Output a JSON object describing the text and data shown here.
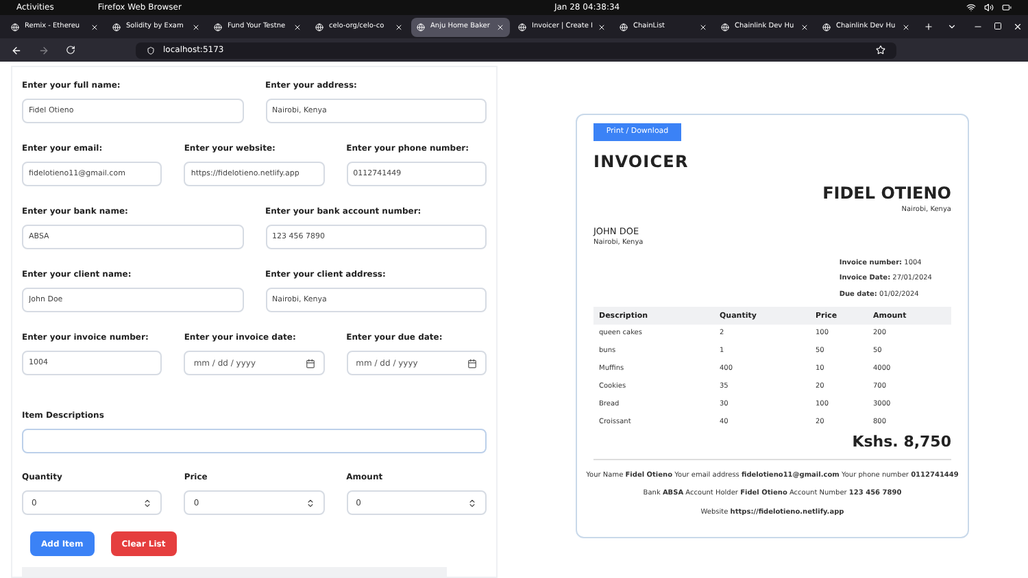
{
  "system_bar": {
    "activities": "Activities",
    "app": "Firefox Web Browser",
    "clock": "Jan 28  04:38:34"
  },
  "tabs": [
    {
      "title": "Remix - Ethereu",
      "selected": false
    },
    {
      "title": "Solidity by Exam",
      "selected": false
    },
    {
      "title": "Fund Your Testne",
      "selected": false
    },
    {
      "title": "celo-org/celo-co",
      "selected": false
    },
    {
      "title": "Anju Home Baker",
      "selected": true
    },
    {
      "title": "Invoicer | Create I",
      "selected": false
    },
    {
      "title": "ChainList",
      "selected": false
    },
    {
      "title": "Chainlink Dev Hu",
      "selected": false
    },
    {
      "title": "Chainlink Dev Hu",
      "selected": false
    }
  ],
  "url": "localhost:5173",
  "form": {
    "rows": [
      [
        {
          "label": "Enter your full name:",
          "value": "Fidel Otieno",
          "kind": "text"
        },
        {
          "label": "Enter your address:",
          "value": "Nairobi, Kenya",
          "kind": "text"
        }
      ],
      [
        {
          "label": "Enter your email:",
          "value": "fidelotieno11@gmail.com",
          "kind": "text"
        },
        {
          "label": "Enter your website:",
          "value": "https://fidelotieno.netlify.app",
          "kind": "text"
        },
        {
          "label": "Enter your phone number:",
          "value": "0112741449",
          "kind": "text"
        }
      ],
      [
        {
          "label": "Enter your bank name:",
          "value": "ABSA",
          "kind": "text"
        },
        {
          "label": "Enter your bank account number:",
          "value": "123 456 7890",
          "kind": "text"
        }
      ],
      [
        {
          "label": "Enter your client name:",
          "value": "John Doe",
          "kind": "text"
        },
        {
          "label": "Enter your client address:",
          "value": "Nairobi, Kenya",
          "kind": "text"
        }
      ],
      [
        {
          "label": "Enter your invoice number:",
          "value": "1004",
          "kind": "text"
        },
        {
          "label": "Enter your invoice date:",
          "value": "mm / dd / yyyy",
          "kind": "date"
        },
        {
          "label": "Enter your due date:",
          "value": "mm / dd / yyyy",
          "kind": "date"
        }
      ]
    ],
    "item_description": {
      "label": "Item Descriptions"
    },
    "item_numbers": [
      {
        "label": "Quantity",
        "value": "0"
      },
      {
        "label": "Price",
        "value": "0"
      },
      {
        "label": "Amount",
        "value": "0"
      }
    ],
    "buttons": [
      {
        "label": "Add Item",
        "kind": "primary"
      },
      {
        "label": "Clear List",
        "kind": "danger"
      }
    ]
  },
  "invoice": {
    "print_button": "Print / Download",
    "title": "INVOICER",
    "sender_name": "FIDEL OTIENO",
    "sender_address": "Nairobi, Kenya",
    "client_name": "JOHN DOE",
    "client_address": "Nairobi, Kenya",
    "meta": [
      {
        "label": "Invoice number:",
        "value": "1004"
      },
      {
        "label": "Invoice Date:",
        "value": "27/01/2024"
      },
      {
        "label": "Due date:",
        "value": "01/02/2024"
      }
    ],
    "table": {
      "columns": [
        "Description",
        "Quantity",
        "Price",
        "Amount"
      ],
      "rows": [
        [
          "queen cakes",
          "2",
          "100",
          "200"
        ],
        [
          "buns",
          "1",
          "50",
          "50"
        ],
        [
          "Muffins",
          "400",
          "10",
          "4000"
        ],
        [
          "Cookies",
          "35",
          "20",
          "700"
        ],
        [
          "Bread",
          "30",
          "100",
          "3000"
        ],
        [
          "Croissant",
          "40",
          "20",
          "800"
        ]
      ]
    },
    "total": "Kshs. 8,750",
    "footer": [
      "Your Name **Fidel Otieno**  Your email address **fidelotieno11@gmail.com**  Your phone number **0112741449**",
      "Bank **ABSA**  Account Holder **Fidel Otieno**  Account Number **123 456 7890**",
      "Website **https://fidelotieno.netlify.app**"
    ]
  }
}
